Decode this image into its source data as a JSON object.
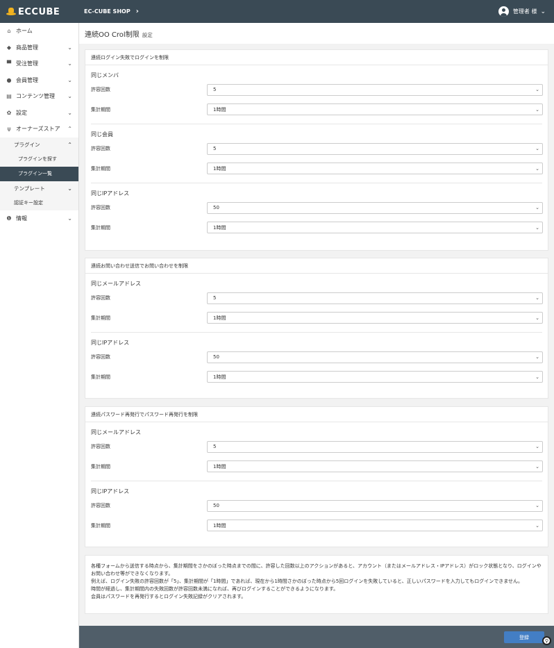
{
  "header": {
    "logo_text": "ECCUBE",
    "shop_link": "EC-CUBE SHOP",
    "shop_chevron": "›",
    "user_name": "管理者 様",
    "user_caret": "⌄"
  },
  "sidebar": {
    "items": [
      {
        "icon": "home-icon",
        "glyph": "⌂",
        "label": "ホーム"
      },
      {
        "icon": "cube-icon",
        "glyph": "◆",
        "label": "商品管理",
        "arrow": "⌄"
      },
      {
        "icon": "cart-icon",
        "glyph": "▀",
        "label": "受注管理",
        "arrow": "⌄"
      },
      {
        "icon": "users-icon",
        "glyph": "●",
        "label": "会員管理",
        "arrow": "⌄"
      },
      {
        "icon": "file-icon",
        "glyph": "▤",
        "label": "コンテンツ管理",
        "arrow": "⌄"
      },
      {
        "icon": "gear-icon",
        "glyph": "✿",
        "label": "設定",
        "arrow": "⌄"
      },
      {
        "icon": "plug-icon",
        "glyph": "ψ",
        "label": "オーナーズストア",
        "arrow": "⌃"
      }
    ],
    "plugin_label": "プラグイン",
    "plugin_arrow": "⌃",
    "plugin_search": "プラグインを探す",
    "plugin_list": "プラグイン一覧",
    "template_label": "テンプレート",
    "template_arrow": "⌄",
    "auth_key": "認証キー設定",
    "info_label": "情報",
    "info_arrow": "⌄"
  },
  "main": {
    "title": "連続OO Crol制限",
    "title_sub": "設定"
  },
  "cards": [
    {
      "header": "連続ログイン失敗でログインを制限",
      "groups": [
        {
          "title": "同じメンバ",
          "rows": [
            {
              "label": "許容回数",
              "value": "5"
            },
            {
              "label": "集計期間",
              "value": "1時間"
            }
          ]
        },
        {
          "title": "同じ会員",
          "rows": [
            {
              "label": "許容回数",
              "value": "5"
            },
            {
              "label": "集計期間",
              "value": "1時間"
            }
          ]
        },
        {
          "title": "同じIPアドレス",
          "rows": [
            {
              "label": "許容回数",
              "value": "50"
            },
            {
              "label": "集計期間",
              "value": "1時間"
            }
          ]
        }
      ]
    },
    {
      "header": "連続お問い合わせ送信でお問い合わせを制限",
      "groups": [
        {
          "title": "同じメールアドレス",
          "rows": [
            {
              "label": "許容回数",
              "value": "5"
            },
            {
              "label": "集計期間",
              "value": "1時間"
            }
          ]
        },
        {
          "title": "同じIPアドレス",
          "rows": [
            {
              "label": "許容回数",
              "value": "50"
            },
            {
              "label": "集計期間",
              "value": "1時間"
            }
          ]
        }
      ]
    },
    {
      "header": "連続パスワード再発行でパスワード再発行を制限",
      "groups": [
        {
          "title": "同じメールアドレス",
          "rows": [
            {
              "label": "許容回数",
              "value": "5"
            },
            {
              "label": "集計期間",
              "value": "1時間"
            }
          ]
        },
        {
          "title": "同じIPアドレス",
          "rows": [
            {
              "label": "許容回数",
              "value": "50"
            },
            {
              "label": "集計期間",
              "value": "1時間"
            }
          ]
        }
      ]
    }
  ],
  "note": {
    "lines": [
      "各種フォームから送信する時点から、集計期間をさかのぼった時点までの間に、許容した回数以上のアクションがあると、アカウント（またはメールアドレス・IPアドレス）がロック状態となり、ログインやお問い合わせ等ができなくなります。",
      "例えば、ログイン失敗の許容回数が「5」、集計期間が「1時間」であれば、現在から1時間さかのぼった時点から5回ログインを失敗していると、正しいパスワードを入力してもログインできません。",
      "時間が経過し、集計期間内の失敗回数が許容回数未満になれば、再びログインすることができるようになります。",
      "会員はパスワードを再発行するとログイン失敗記録がクリアされます。"
    ]
  },
  "footer": {
    "save_label": "登録",
    "corner_icon_glyph": "⚲"
  },
  "select_arrow": "⌄"
}
